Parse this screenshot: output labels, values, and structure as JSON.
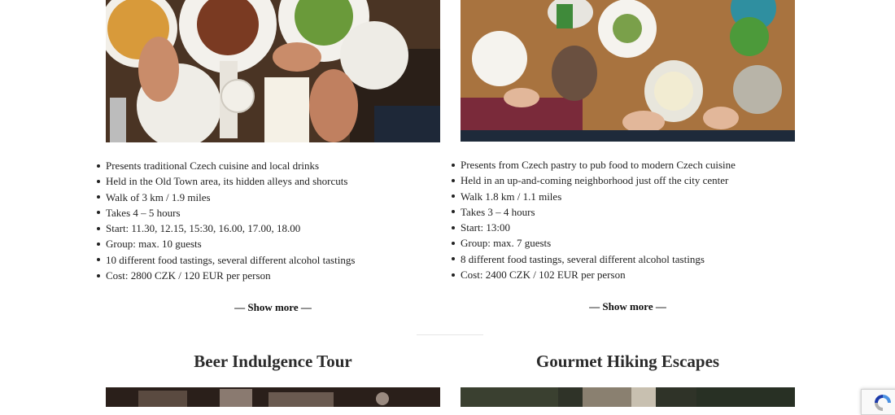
{
  "tours": [
    {
      "photo_icon": "food-table-photo",
      "details": [
        "Presents traditional Czech cuisine and local drinks",
        "Held in the Old Town area, its hidden alleys and shorcuts",
        "Walk of 3 km / 1.9 miles",
        "Takes 4 – 5 hours",
        "Start: 11.30, 12.15, 15:30, 16.00, 17.00, 18.00",
        "Group: max. 10 guests",
        "10 different food tastings, several different alcohol tastings",
        "Cost: 2800 CZK / 120 EUR per person"
      ],
      "show_more": "— Show more —"
    },
    {
      "photo_icon": "food-table-photo",
      "details": [
        "Presents from Czech pastry to pub food to modern Czech cuisine",
        "Held in an up-and-coming neighborhood just off the city center",
        "Walk 1.8 km / 1.1 miles",
        "Takes 3 – 4 hours",
        "Start: 13:00",
        "Group: max. 7 guests",
        "8 different food tastings, several different alcohol tastings",
        "Cost: 2400 CZK / 102 EUR per person"
      ],
      "show_more": "— Show more —"
    }
  ],
  "next_tours": [
    {
      "title": "Beer Indulgence Tour"
    },
    {
      "title": "Gourmet Hiking Escapes"
    }
  ],
  "colors": {
    "text": "#222222",
    "heading": "#2b2b2b",
    "divider": "#e6e6e6"
  }
}
